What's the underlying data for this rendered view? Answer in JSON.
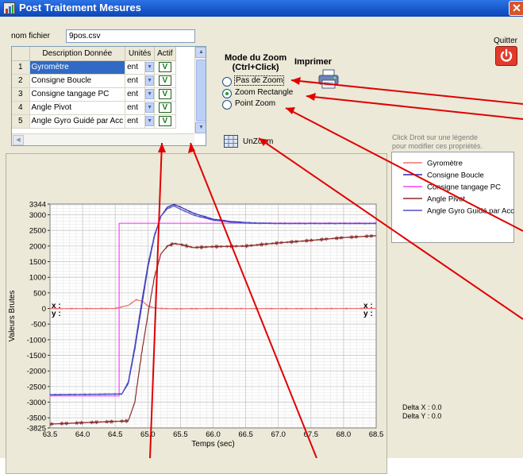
{
  "window": {
    "title": "Post Traitement Mesures",
    "close_glyph": "✕"
  },
  "file": {
    "label": "nom fichier",
    "value": "9pos.csv"
  },
  "quit": {
    "label": "Quitter",
    "icon": "power-icon"
  },
  "grid": {
    "columns": [
      "",
      "Description Donnée",
      "Unités",
      "Actif"
    ],
    "rows": [
      {
        "n": "1",
        "desc": "Gyromètre",
        "unit": "ent",
        "active": "V",
        "selected": true
      },
      {
        "n": "2",
        "desc": "Consigne Boucle",
        "unit": "ent",
        "active": "V"
      },
      {
        "n": "3",
        "desc": "Consigne tangage PC",
        "unit": "ent",
        "active": "V"
      },
      {
        "n": "4",
        "desc": "Angle Pivot",
        "unit": "ent",
        "active": "V"
      },
      {
        "n": "5",
        "desc": "Angle Gyro Guidé par Acc",
        "unit": "ent",
        "active": "V"
      }
    ]
  },
  "zoom": {
    "title_line1": "Mode du Zoom",
    "title_line2": "(Ctrl+Click)",
    "options": [
      "Pas de Zoom",
      "Zoom Rectangle",
      "Point Zoom"
    ],
    "selected": "Zoom Rectangle",
    "unzoom_label": "UnZoom"
  },
  "print": {
    "label": "Imprimer",
    "icon": "printer-icon"
  },
  "legend": {
    "hint_line1": "Click Droit sur une légende",
    "hint_line2": "pour modifier ces propriétés.",
    "items": [
      {
        "name": "Gyromètre",
        "color": "#f07070"
      },
      {
        "name": "Consigne Boucle",
        "color": "#2a2ab0"
      },
      {
        "name": "Consigne tangage PC",
        "color": "#ff40ff"
      },
      {
        "name": "Angle Pivot",
        "color": "#8b2a2a"
      },
      {
        "name": "Angle Gyro Guidé par Acc",
        "color": "#5050c8"
      }
    ]
  },
  "cursor": {
    "x_label": "x :",
    "y_label": "y :"
  },
  "delta": {
    "x": "Delta X : 0.0",
    "y": "Delta Y : 0.0"
  },
  "chart_data": {
    "type": "line",
    "xlabel": "Temps (sec)",
    "ylabel": "Valeurs Brutes",
    "xlim": [
      63.5,
      68.5
    ],
    "ylim": [
      -3825,
      3344
    ],
    "xticks": [
      "63.5",
      "64.0",
      "64.5",
      "65.0",
      "65.5",
      "66.0",
      "66.5",
      "67.0",
      "67.5",
      "68.0",
      "68.5"
    ],
    "yticks": [
      "3344",
      "3000",
      "2500",
      "2000",
      "1500",
      "1000",
      "500",
      "0",
      "-500",
      "-1000",
      "-1500",
      "-2000",
      "-2500",
      "-3000",
      "-3500",
      "-3825"
    ],
    "grid": true,
    "series": [
      {
        "name": "Gyromètre",
        "color": "#f07070",
        "x": [
          63.5,
          64.5,
          64.7,
          64.82,
          64.92,
          65.0,
          65.1,
          65.2,
          65.4,
          66.0,
          67.0,
          68.0,
          68.5
        ],
        "y": [
          -5,
          0,
          100,
          280,
          230,
          80,
          20,
          0,
          -10,
          0,
          -5,
          0,
          0
        ]
      },
      {
        "name": "Consigne Boucle",
        "color": "#2a2ab0",
        "x": [
          63.5,
          64.6,
          64.7,
          64.8,
          64.9,
          65.0,
          65.1,
          65.2,
          65.3,
          65.4,
          65.5,
          65.7,
          66.0,
          66.3,
          66.6,
          67.0,
          68.0,
          68.5
        ],
        "y": [
          -2760,
          -2740,
          -2400,
          -1300,
          0,
          1300,
          2300,
          2950,
          3250,
          3330,
          3250,
          3050,
          2860,
          2780,
          2740,
          2730,
          2730,
          2730
        ]
      },
      {
        "name": "Consigne tangage PC",
        "color": "#ff40ff",
        "x": [
          63.5,
          64.56,
          64.56,
          68.5
        ],
        "y": [
          -2800,
          -2800,
          2730,
          2730
        ]
      },
      {
        "name": "Angle Pivot",
        "color": "#8b2a2a",
        "x": [
          63.5,
          64.7,
          64.8,
          64.9,
          65.0,
          65.1,
          65.2,
          65.3,
          65.4,
          65.5,
          65.7,
          66.0,
          66.5,
          67.0,
          67.5,
          68.0,
          68.5
        ],
        "y": [
          -3700,
          -3600,
          -3000,
          -1500,
          -200,
          1000,
          1750,
          2000,
          2080,
          2050,
          1950,
          1980,
          2000,
          2100,
          2180,
          2270,
          2330
        ]
      },
      {
        "name": "Angle Gyro Guidé par Acc",
        "color": "#5050c8",
        "x": [
          63.5,
          64.6,
          64.7,
          64.8,
          64.9,
          65.0,
          65.1,
          65.2,
          65.3,
          65.4,
          65.5,
          65.7,
          66.0,
          66.3,
          66.6,
          67.0,
          68.0,
          68.5
        ],
        "y": [
          -2760,
          -2740,
          -2350,
          -1200,
          150,
          1400,
          2350,
          2950,
          3200,
          3280,
          3180,
          2990,
          2830,
          2760,
          2730,
          2720,
          2720,
          2720
        ]
      }
    ]
  }
}
